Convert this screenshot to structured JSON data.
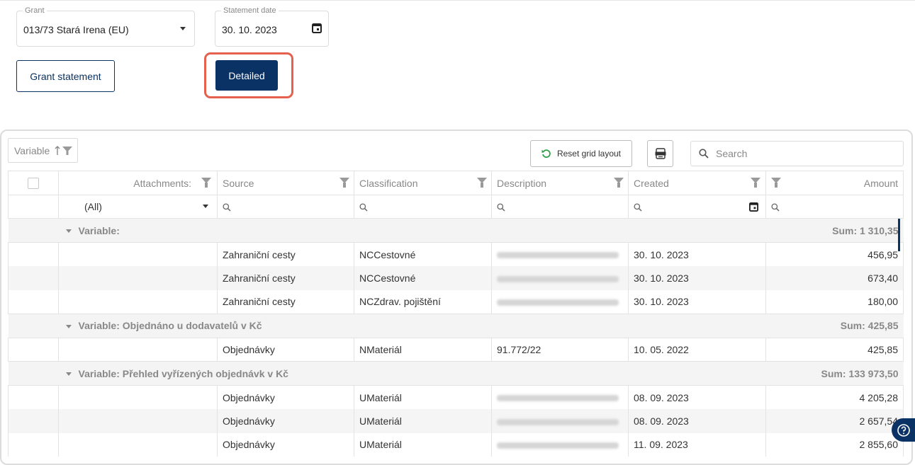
{
  "filters": {
    "grant": {
      "label": "Grant",
      "value": "013/73 Stará Irena (EU)"
    },
    "statement_date": {
      "label": "Statement date",
      "value": "30. 10. 2023"
    }
  },
  "actions": {
    "grant_statement": "Grant statement",
    "detailed": "Detailed"
  },
  "toolbar": {
    "group_chip": "Variable",
    "reset_label": "Reset grid layout",
    "search_placeholder": "Search"
  },
  "columns": [
    "Attachments:",
    "Source",
    "Classification",
    "Description",
    "Created",
    "Amount"
  ],
  "filter_row": {
    "attachments": "(All)"
  },
  "groups": [
    {
      "label": "Variable:",
      "sum": "Sum: 1 310,35",
      "rows": [
        {
          "source": "Zahraniční cesty",
          "classification": "NCCestovné",
          "created": "30. 10. 2023",
          "amount": "456,95"
        },
        {
          "source": "Zahraniční cesty",
          "classification": "NCCestovné",
          "created": "30. 10. 2023",
          "amount": "673,40"
        },
        {
          "source": "Zahraniční cesty",
          "classification": "NCZdrav. pojištění",
          "created": "30. 10. 2023",
          "amount": "180,00"
        }
      ]
    },
    {
      "label": "Variable: Objednáno u dodavatelů v Kč",
      "sum": "Sum: 425,85",
      "rows": [
        {
          "source": "Objednávky",
          "classification": "NMateriál",
          "description": "91.772/22",
          "created": "10. 05. 2022",
          "amount": "425,85"
        }
      ]
    },
    {
      "label": "Variable: Přehled vyřízených objednávk v Kč",
      "sum": "Sum: 133 973,50",
      "rows": [
        {
          "source": "Objednávky",
          "classification": "UMateriál",
          "created": "08. 09. 2023",
          "amount": "4 205,28"
        },
        {
          "source": "Objednávky",
          "classification": "UMateriál",
          "created": "08. 09. 2023",
          "amount": "2 657,54"
        },
        {
          "source": "Objednávky",
          "classification": "UMateriál",
          "created": "11. 09. 2023",
          "amount": "2 855,60"
        }
      ]
    }
  ],
  "colors": {
    "primary": "#0b3264",
    "highlight": "#e5604d",
    "group_bg": "#f4f4f4"
  },
  "icons": [
    "chevron-down-icon",
    "calendar-icon",
    "sort-up-icon",
    "filter-icon",
    "refresh-icon",
    "excel-export-icon",
    "search-icon",
    "help-icon"
  ]
}
